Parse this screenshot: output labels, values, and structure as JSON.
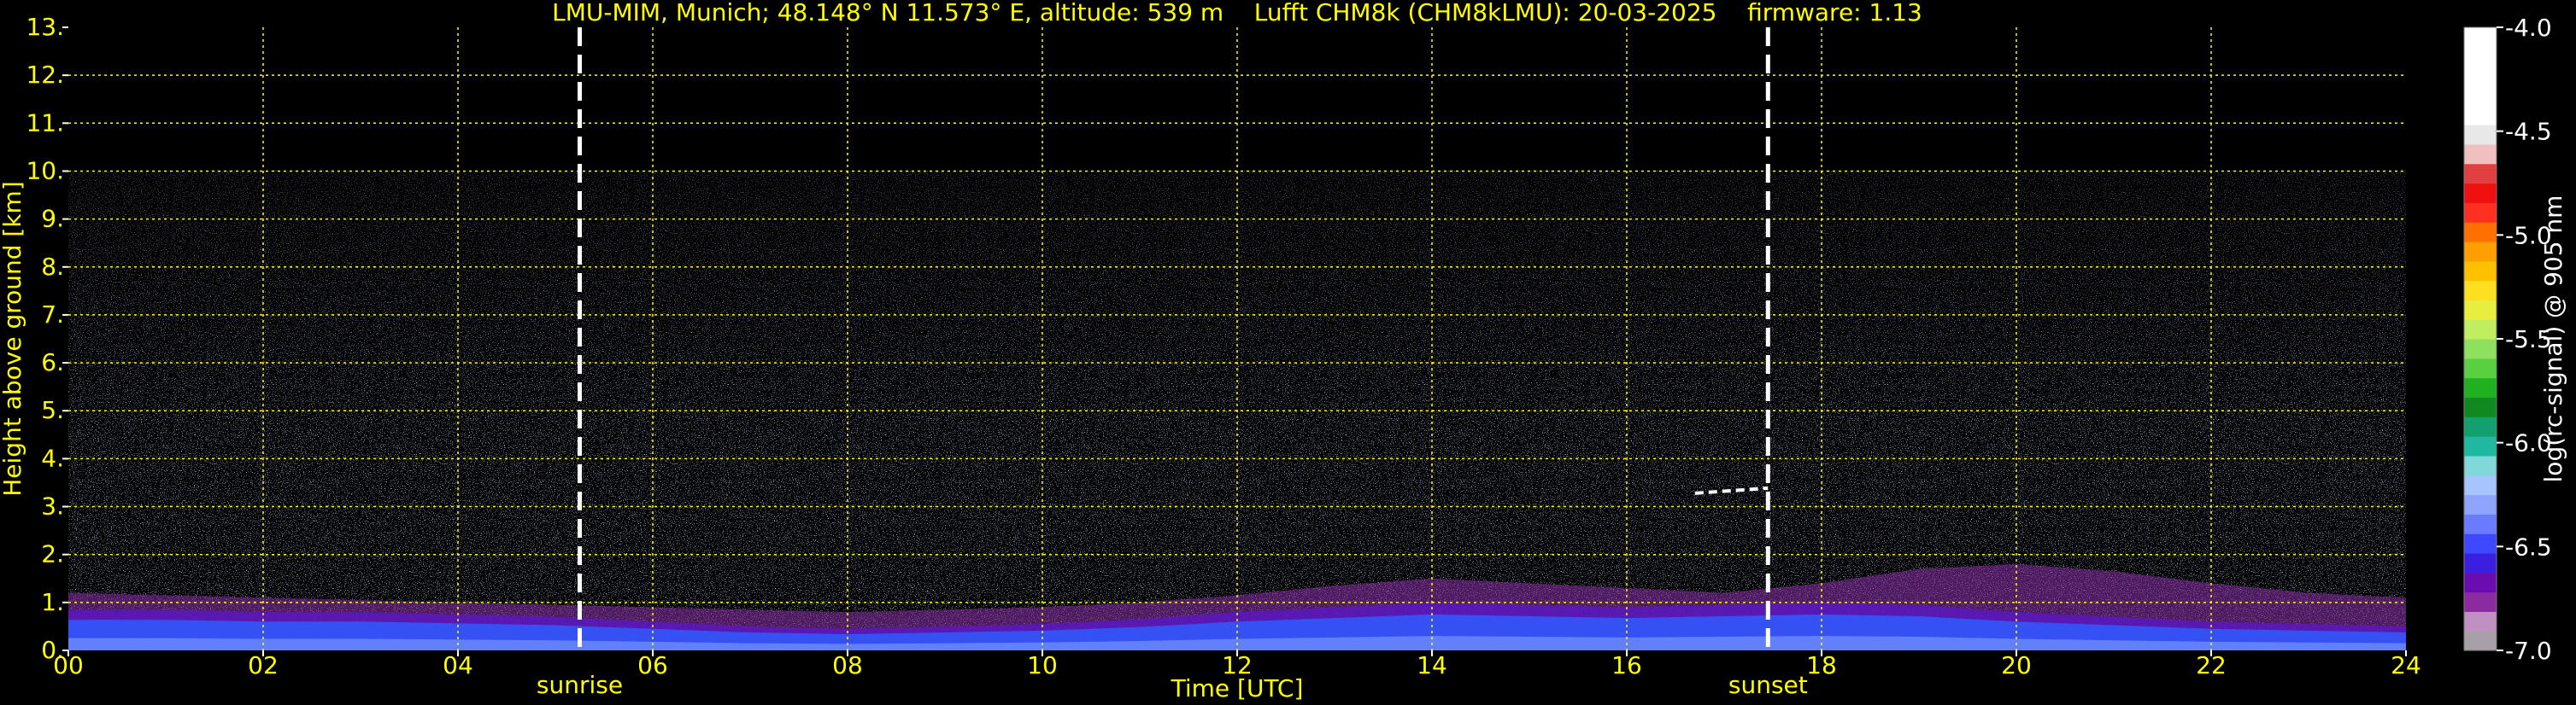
{
  "chart_data": {
    "type": "heatmap",
    "title": "LMU-MIM, Munich; 48.148° N 11.573° E, altitude: 539 m    Lufft CHM8k (CHM8kLMU): 20-03-2025    firmware: 1.13",
    "xlabel": "Time [UTC]",
    "ylabel": "Height above ground [km]",
    "colorbar_label": "log(rc-signal) @ 905 nm",
    "xlim": [
      0,
      24
    ],
    "ylim": [
      0,
      13
    ],
    "x_ticks": [
      0,
      2,
      4,
      6,
      8,
      10,
      12,
      14,
      16,
      18,
      20,
      22,
      24
    ],
    "x_tick_labels": [
      "00",
      "02",
      "04",
      "06",
      "08",
      "10",
      "12",
      "14",
      "16",
      "18",
      "20",
      "22",
      "24"
    ],
    "y_ticks": [
      0,
      1,
      2,
      3,
      4,
      5,
      6,
      7,
      8,
      9,
      10,
      11,
      12,
      13
    ],
    "y_tick_labels": [
      "0.",
      "1.",
      "2.",
      "3.",
      "4.",
      "5.",
      "6.",
      "7.",
      "8.",
      "9.",
      "10.",
      "11.",
      "12.",
      "13."
    ],
    "grid": true,
    "grid_color": "#ffff00",
    "colorbar_range": [
      -7.0,
      -4.0
    ],
    "colorbar_ticks": [
      -4.0,
      -4.5,
      -5.0,
      -5.5,
      -6.0,
      -6.5,
      -7.0
    ],
    "colorbar_tick_labels": [
      "-4.0",
      "-4.5",
      "-5.0",
      "-5.5",
      "-6.0",
      "-6.5",
      "-7.0"
    ],
    "colorbar_colors": [
      "#a8a0a8",
      "#c090c0",
      "#8c2ba0",
      "#6a0cb0",
      "#3a1fe0",
      "#3d48ff",
      "#6a7bff",
      "#8ea4ff",
      "#a8c4ff",
      "#80d8d8",
      "#20b8a0",
      "#12a070",
      "#108a20",
      "#20b020",
      "#58d040",
      "#90e060",
      "#c0ee60",
      "#e8ee40",
      "#ffe020",
      "#ffc000",
      "#ffa000",
      "#ff7000",
      "#ff3020",
      "#f01010",
      "#e04040",
      "#f0c0c0",
      "#e8e8e8",
      "#ffffff",
      "#ffffff",
      "#ffffff",
      "#ffffff",
      "#ffffff"
    ],
    "signal_top_km": 10.0,
    "events": [
      {
        "label": "sunrise",
        "time": 5.25
      },
      {
        "label": "sunset",
        "time": 17.45
      }
    ],
    "boundary_layer": {
      "hours": [
        0,
        1,
        2,
        3,
        4,
        5,
        6,
        7,
        8,
        9,
        10,
        11,
        12,
        13,
        14,
        15,
        16,
        17,
        18,
        19,
        20,
        21,
        22,
        23,
        24
      ],
      "aerosol_top_km": [
        1.2,
        1.15,
        1.1,
        1.05,
        1.0,
        0.95,
        0.9,
        0.85,
        0.8,
        0.85,
        0.9,
        1.0,
        1.15,
        1.35,
        1.5,
        1.4,
        1.3,
        1.2,
        1.4,
        1.7,
        1.8,
        1.65,
        1.4,
        1.2,
        1.1
      ],
      "dense_top_km": [
        0.85,
        0.85,
        0.8,
        0.8,
        0.75,
        0.7,
        0.6,
        0.5,
        0.45,
        0.5,
        0.55,
        0.65,
        0.8,
        0.9,
        1.0,
        0.95,
        0.9,
        0.95,
        1.0,
        0.95,
        0.8,
        0.7,
        0.6,
        0.55,
        0.5
      ]
    },
    "cloud_layer": {
      "start_hour": 16.7,
      "end_hour": 17.45,
      "height_km": 3.35
    }
  }
}
